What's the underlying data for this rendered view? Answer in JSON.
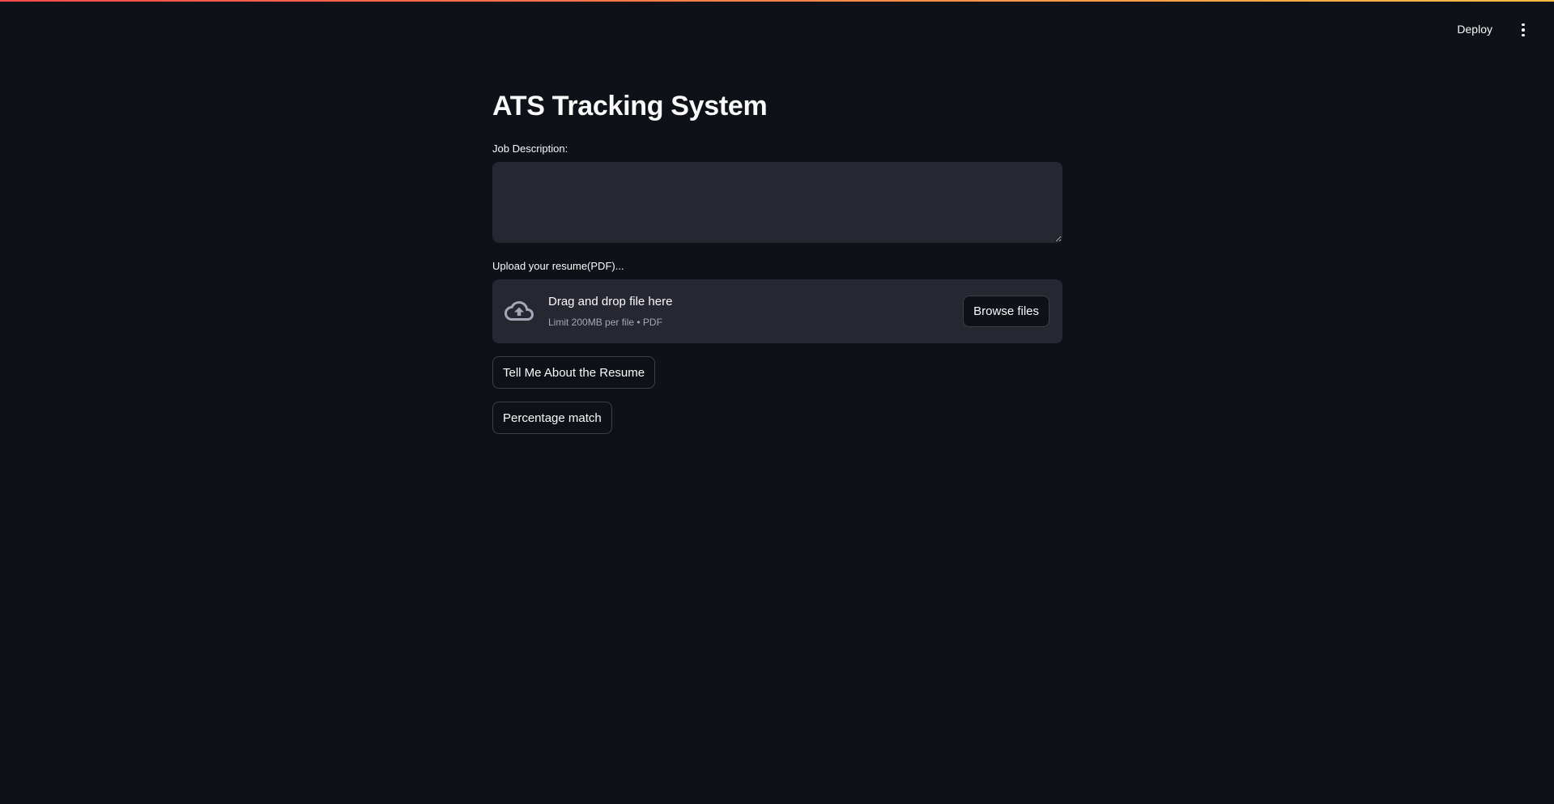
{
  "header": {
    "deploy_label": "Deploy",
    "menu_icon": "vertical-ellipsis-icon"
  },
  "main": {
    "title": "ATS Tracking System",
    "job_description": {
      "label": "Job Description:",
      "value": ""
    },
    "uploader": {
      "label": "Upload your resume(PDF)...",
      "drop_title": "Drag and drop file here",
      "drop_limit": "Limit 200MB per file • PDF",
      "browse_label": "Browse files",
      "icon": "cloud-upload-icon"
    },
    "buttons": {
      "tell_me": "Tell Me About the Resume",
      "percentage_match": "Percentage match"
    }
  },
  "colors": {
    "background": "#0e1117",
    "surface": "#262730",
    "text": "#fafafa",
    "muted_text": "#a3a8b8",
    "accent_gradient_start": "#ff4b4b",
    "accent_gradient_end": "#ffbd45"
  }
}
